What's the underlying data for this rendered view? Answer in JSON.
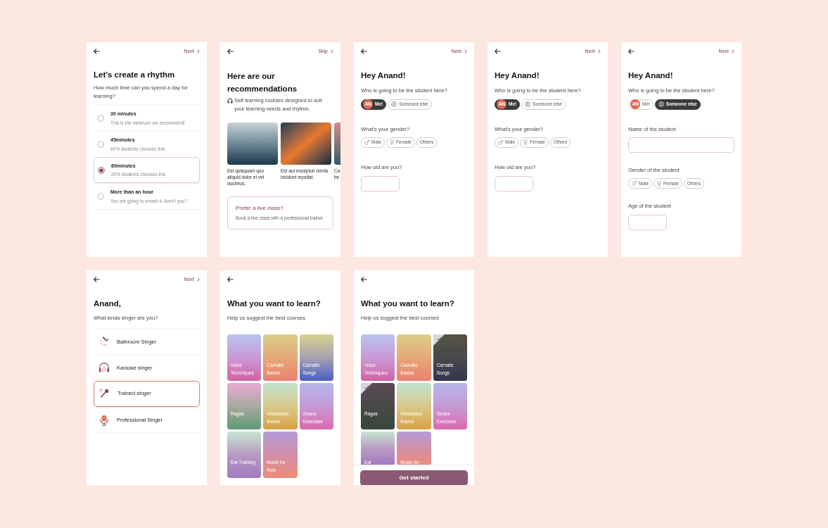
{
  "screens": [
    {
      "kind": "rhythm",
      "action": "Next",
      "title": "Let’s create a rhythm",
      "subtitle": "How much time can you spend a day for learning?",
      "options": [
        {
          "label": "30 minutes",
          "note": "This is the minimum we recommend!",
          "selected": false
        },
        {
          "label": "45minutes",
          "note": "60% students chooses this",
          "selected": false
        },
        {
          "label": "60minutes",
          "note": "20% students chooses this",
          "selected": true
        },
        {
          "label": "More than an hour",
          "note": "You are going to smash it. Aren't you?",
          "selected": false
        }
      ]
    },
    {
      "kind": "recommendations",
      "action": "Skip",
      "title": "Here are our recommendations",
      "subtitle": "Self learning courses designed to suit your learning needs and rhythm.",
      "courses": [
        {
          "caption": "Est quisquam quo aliquid dolor et vel ducimus."
        },
        {
          "caption": "Est aut excepturi omnis incidunt repellat."
        },
        {
          "caption": "Ca be"
        }
      ],
      "live_class": {
        "title": "Prefer a live class?",
        "note": "Book a live class with a professional trainer"
      }
    },
    {
      "kind": "student",
      "action": "Next",
      "title": "Hey Anand!",
      "question": "Who is going to be the student here?",
      "students": [
        {
          "label": "Me!",
          "avatar": "AN",
          "selected": true
        },
        {
          "label": "Someone else",
          "selected": false
        }
      ],
      "gender_label": "What's your gender?",
      "genders": [
        {
          "label": "Male"
        },
        {
          "label": "Female"
        },
        {
          "label": "Others"
        }
      ],
      "age_label": "How old are you?"
    },
    {
      "kind": "student",
      "action": "Next",
      "title": "Hey Anand!",
      "question": "Who is going to be the student here?",
      "students": [
        {
          "label": "Me!",
          "avatar": "AN",
          "selected": true
        },
        {
          "label": "Someone else",
          "selected": false
        }
      ],
      "gender_label": "What's your gender?",
      "genders": [
        {
          "label": "Male"
        },
        {
          "label": "Female"
        },
        {
          "label": "Others"
        }
      ],
      "age_label": "How old are you?"
    },
    {
      "kind": "student",
      "action": "Next",
      "title": "Hey Anand!",
      "question": "Who is going to be the student here?",
      "students": [
        {
          "label": "Me!",
          "avatar": "AN",
          "selected": false
        },
        {
          "label": "Someone else",
          "selected": true
        }
      ],
      "name_label": "Name of the student",
      "gender_label": "Gender of the student",
      "genders": [
        {
          "label": "Male"
        },
        {
          "label": "Female"
        },
        {
          "label": "Others"
        }
      ],
      "age_label": "Age of the student"
    },
    {
      "kind": "singer",
      "action": "Next",
      "title": "Anand,",
      "subtitle": "What kinda singer are you?",
      "types": [
        {
          "label": "Bathroom Singer",
          "selected": false
        },
        {
          "label": "Karaoke singer",
          "selected": false
        },
        {
          "label": "Trained singer",
          "selected": true
        },
        {
          "label": "Professional Singer",
          "selected": false
        }
      ]
    },
    {
      "kind": "learn",
      "title": "What you want to learn?",
      "subtitle": "Help us suggest the best courses",
      "courses": [
        {
          "label": "Voice Techniques",
          "selected": false
        },
        {
          "label": "Carnatic Basics",
          "selected": false
        },
        {
          "label": "Carnatic Songs",
          "selected": false
        },
        {
          "label": "Ragas",
          "selected": false
        },
        {
          "label": "Hindustani Basics",
          "selected": false
        },
        {
          "label": "Swara Exercises",
          "selected": false
        },
        {
          "label": "Ear Training",
          "selected": false
        },
        {
          "label": "Music for Kids",
          "selected": false
        }
      ]
    },
    {
      "kind": "learn",
      "title": "What you want to learn?",
      "subtitle": "Help us suggest the best courses",
      "courses": [
        {
          "label": "Voice Techniques",
          "selected": false
        },
        {
          "label": "Carnatic Basics",
          "selected": false
        },
        {
          "label": "Carnatic Songs",
          "selected": true
        },
        {
          "label": "Ragas",
          "selected": true
        },
        {
          "label": "Hindustani Basics",
          "selected": false
        },
        {
          "label": "Swara Exercises",
          "selected": false
        },
        {
          "label": "Ear",
          "selected": false
        },
        {
          "label": "Music for",
          "selected": false
        }
      ],
      "button": "Get started"
    }
  ]
}
